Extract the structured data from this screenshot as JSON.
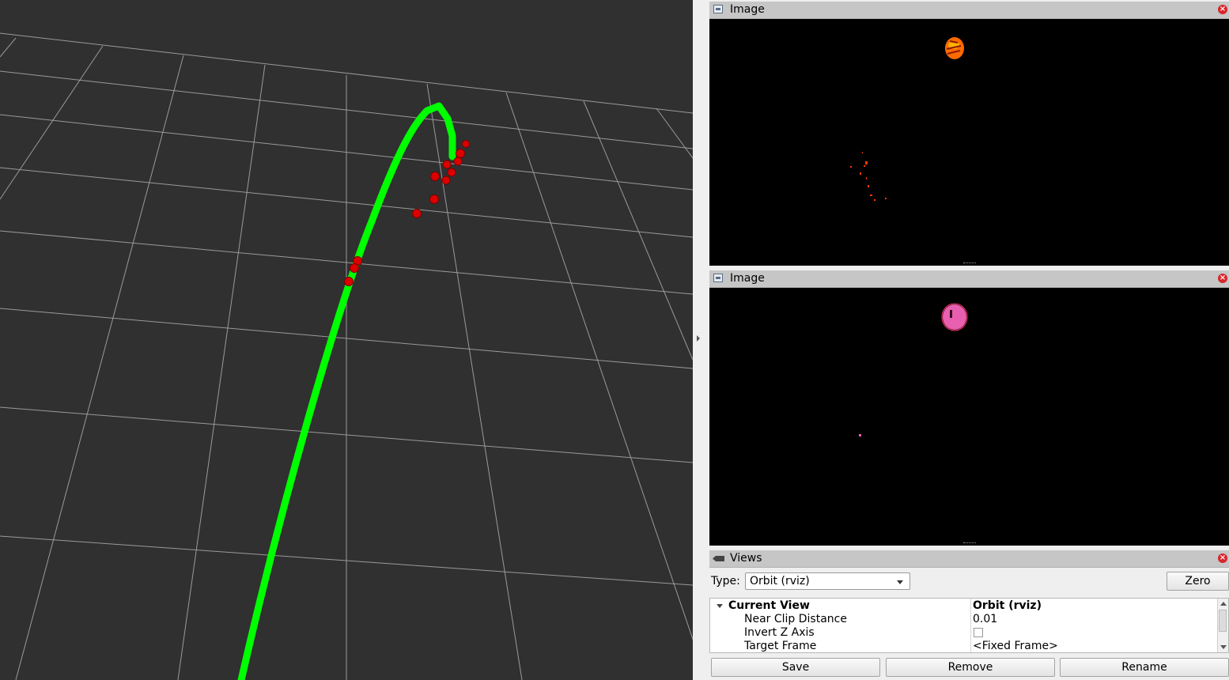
{
  "image_panel_top": {
    "title": "Image"
  },
  "image_panel_bottom": {
    "title": "Image"
  },
  "views": {
    "title": "Views",
    "type_label": "Type:",
    "type_value": "Orbit (rviz)",
    "zero_label": "Zero",
    "properties": [
      {
        "name": "Current View",
        "value": "Orbit (rviz)"
      },
      {
        "name": "Near Clip Distance",
        "value": "0.01"
      },
      {
        "name": "Invert Z Axis",
        "value": ""
      },
      {
        "name": "Target Frame",
        "value": "<Fixed Frame>"
      }
    ],
    "save_label": "Save",
    "remove_label": "Remove",
    "rename_label": "Rename"
  },
  "colors": {
    "grid_background": "#303030",
    "grid_lines": "#a0a0a0",
    "trajectory": "#00ff00",
    "markers": "#e00000",
    "heat_blob": "#ff6a00",
    "mask_blob": "#e85fb0"
  }
}
